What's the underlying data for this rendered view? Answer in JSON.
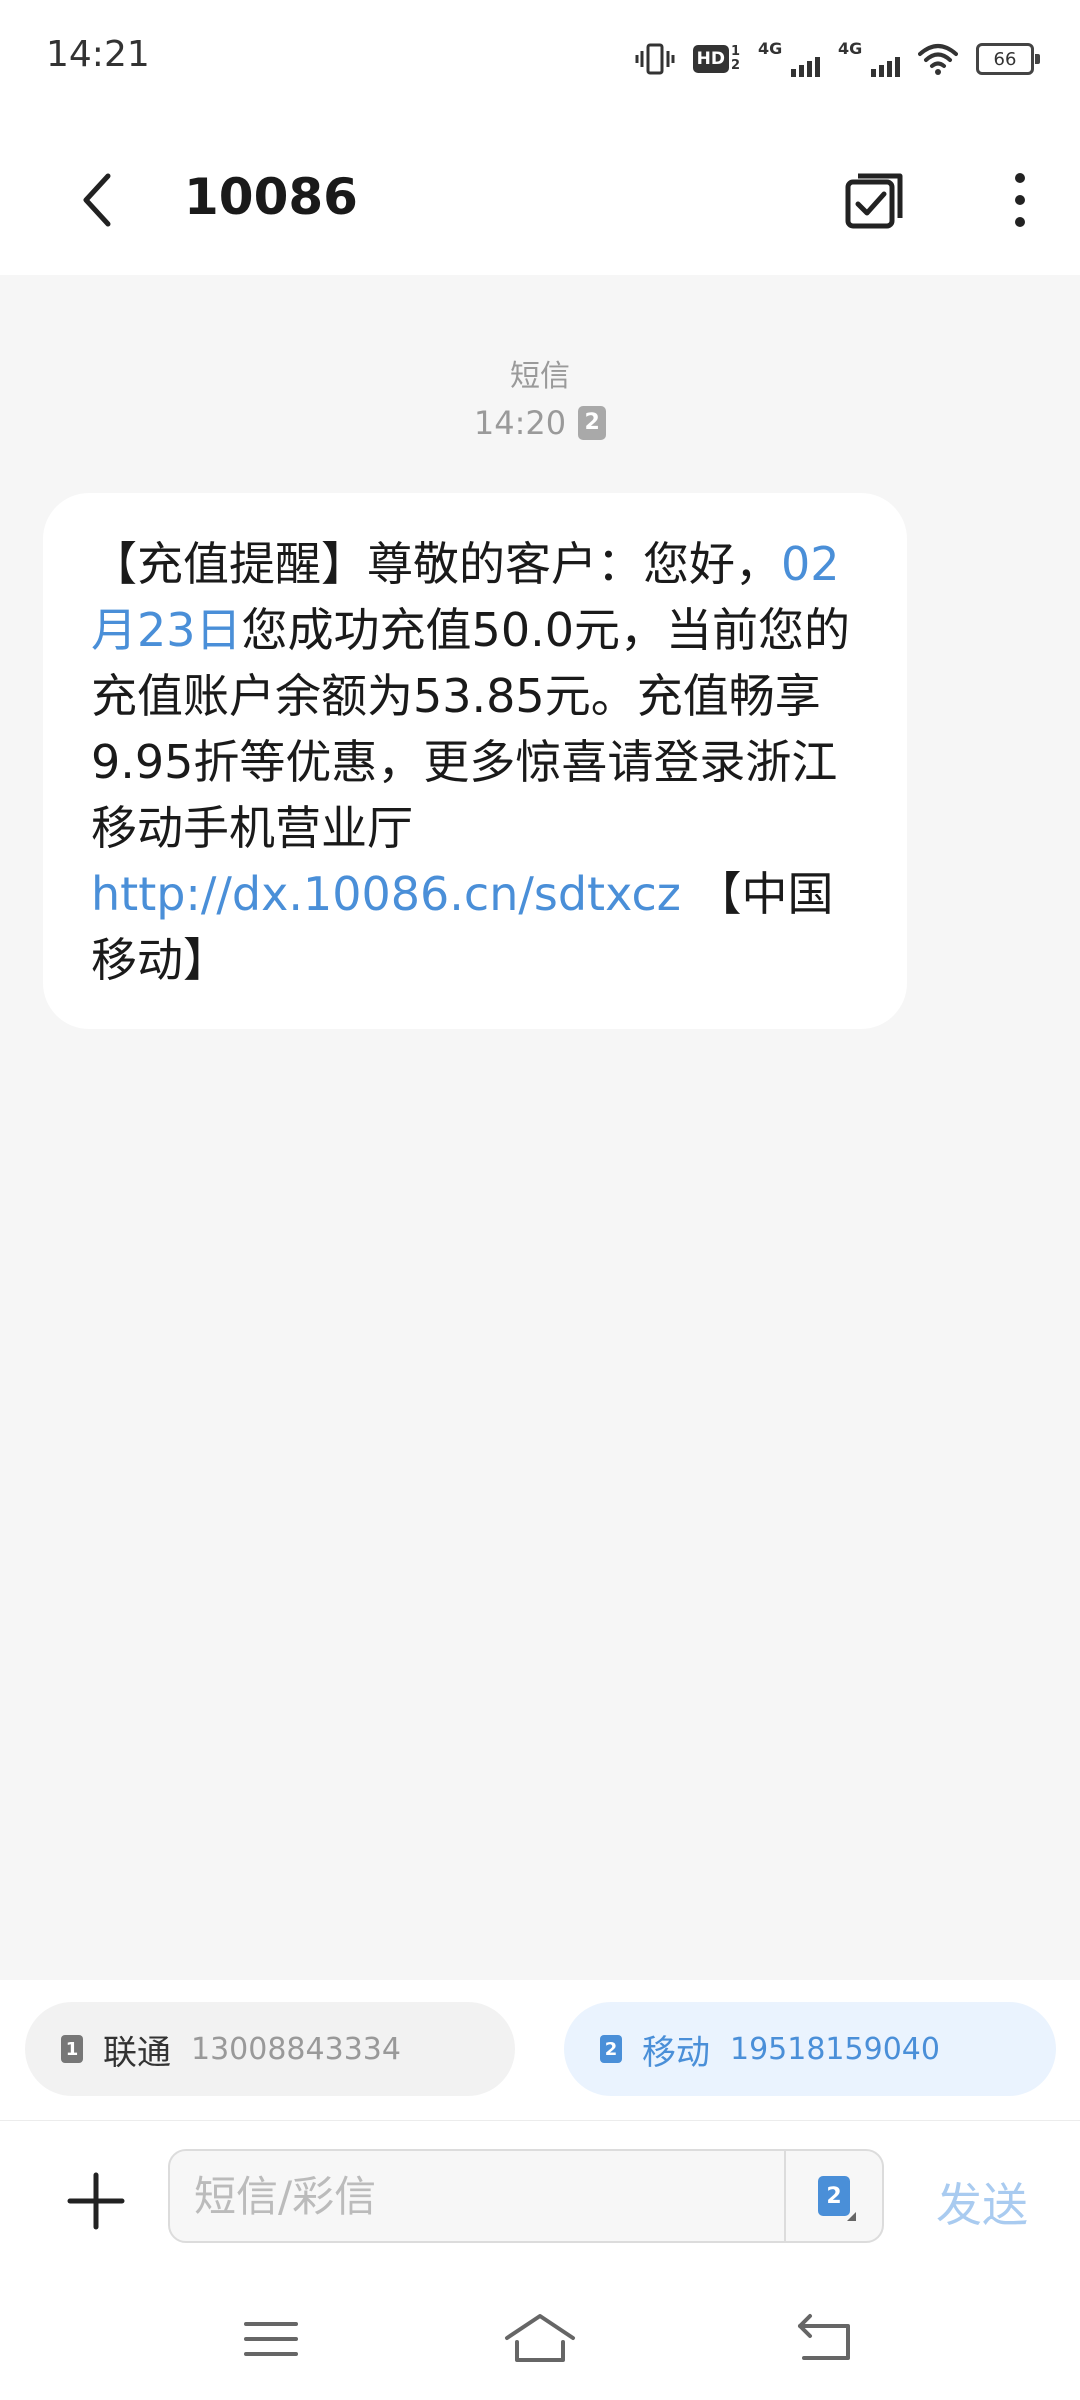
{
  "status_bar": {
    "time": "14:21",
    "signal_1_label": "4G",
    "signal_2_label": "4G",
    "hd_label": "HD",
    "battery_level": "66",
    "icons": [
      "vibrate-icon",
      "hd-voice-icon",
      "signal-icon",
      "signal-icon",
      "wifi-icon",
      "battery-icon"
    ]
  },
  "header": {
    "title": "10086",
    "icons": [
      "back-arrow-icon",
      "select-checkbox-icon",
      "more-vertical-icon"
    ]
  },
  "message": {
    "type_label": "短信",
    "time": "14:20",
    "sim_slot": "2",
    "segments": [
      {
        "text": "【充值提醒】尊敬的客户：您好，",
        "link": false
      },
      {
        "text": "02月23日",
        "link": true
      },
      {
        "text": "您成功充值50.0元，当前您的充值账户余额为53.85元。充值畅享9.95折等优惠，更多惊喜请登录浙江移动手机营业厅",
        "link": false
      },
      {
        "text": "http://dx.10086.cn/sdtxcz",
        "link": true
      },
      {
        "text": " 【中国移动】",
        "link": false
      }
    ]
  },
  "sim_selector": {
    "sim1": {
      "slot": "1",
      "carrier": "联通",
      "number": "13008843334"
    },
    "sim2": {
      "slot": "2",
      "carrier": "移动",
      "number": "19518159040"
    }
  },
  "compose": {
    "placeholder": "短信/彩信",
    "sim_slot": "2",
    "send_label": "发送"
  },
  "colors": {
    "link": "#4a8fd8",
    "send_disabled": "#a9cbf0",
    "selected_sim_background": "#eaf3fe"
  },
  "nav_bar": {
    "icons": [
      "menu-icon",
      "home-icon",
      "back-icon"
    ]
  }
}
